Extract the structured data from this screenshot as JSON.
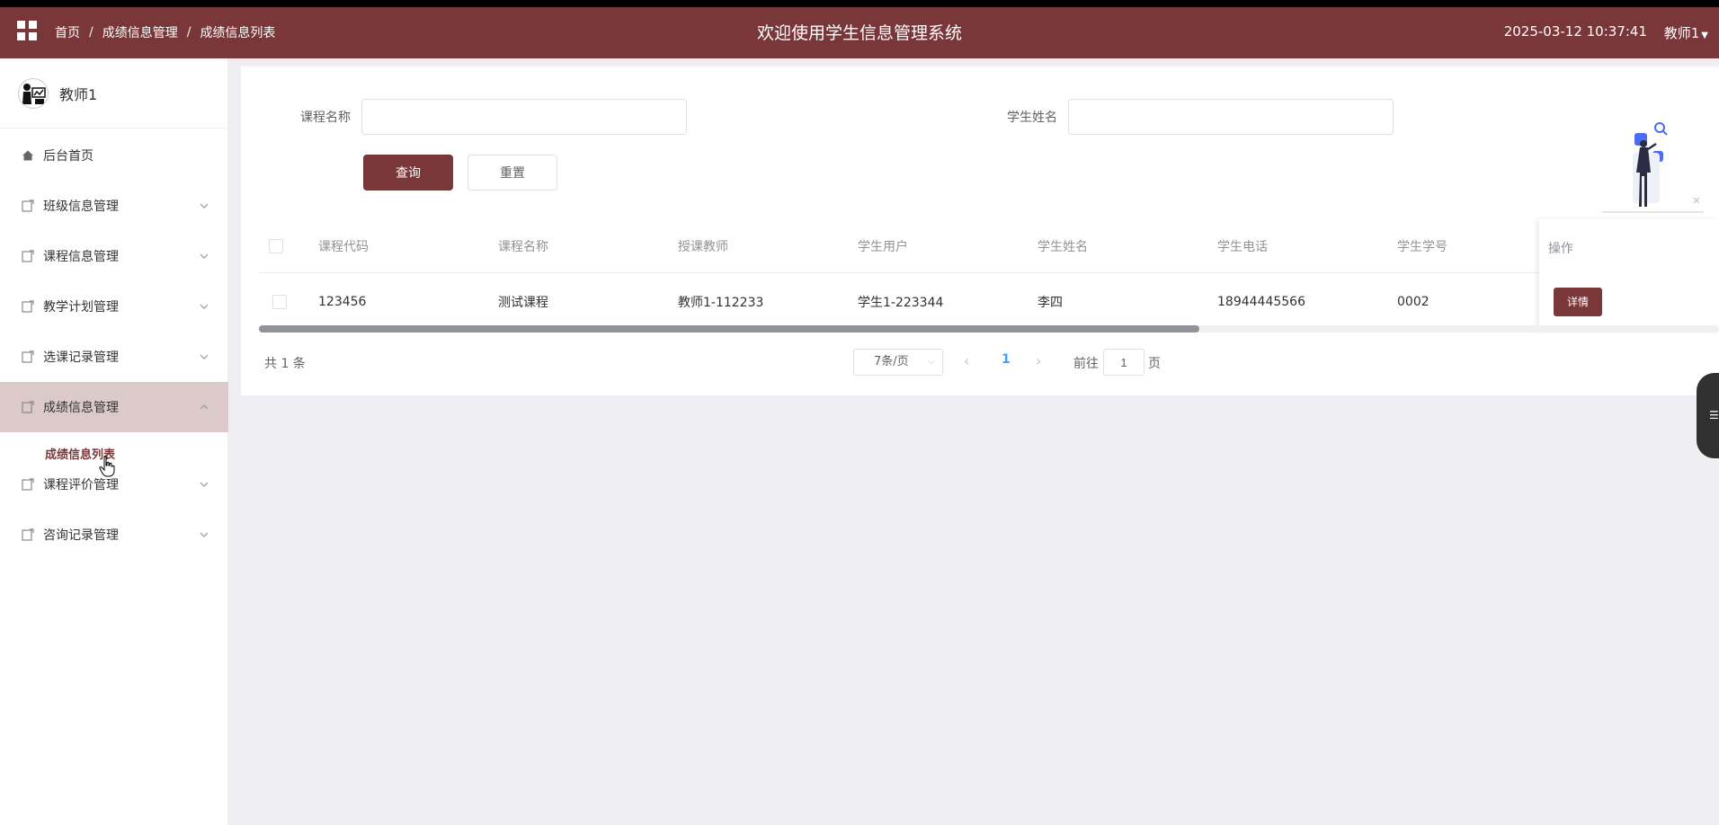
{
  "header": {
    "breadcrumb": [
      "首页",
      "成绩信息管理",
      "成绩信息列表"
    ],
    "title": "欢迎使用学生信息管理系统",
    "datetime": "2025-03-12 10:37:41",
    "user": "教师1"
  },
  "sidebar": {
    "profile_name": "教师1",
    "items": [
      {
        "label": "后台首页",
        "icon": "home-icon"
      },
      {
        "label": "班级信息管理",
        "icon": "doc-icon"
      },
      {
        "label": "课程信息管理",
        "icon": "doc-icon"
      },
      {
        "label": "教学计划管理",
        "icon": "doc-icon"
      },
      {
        "label": "选课记录管理",
        "icon": "doc-icon"
      },
      {
        "label": "成绩信息管理",
        "icon": "doc-icon"
      },
      {
        "label": "课程评价管理",
        "icon": "doc-icon"
      },
      {
        "label": "咨询记录管理",
        "icon": "doc-icon"
      }
    ],
    "subitem": "成绩信息列表"
  },
  "search": {
    "course_label": "课程名称",
    "student_label": "学生姓名",
    "course_value": "",
    "student_value": "",
    "query_label": "查询",
    "reset_label": "重置"
  },
  "table": {
    "columns": [
      "课程代码",
      "课程名称",
      "授课教师",
      "学生用户",
      "学生姓名",
      "学生电话",
      "学生学号"
    ],
    "ops_header": "操作",
    "rows": [
      [
        "123456",
        "测试课程",
        "教师1-112233",
        "学生1-223344",
        "李四",
        "18944445566",
        "0002"
      ]
    ],
    "detail_label": "详情"
  },
  "pager": {
    "total": "共 1 条",
    "size": "7条/页",
    "current": "1",
    "goto_prefix": "前往",
    "goto_value": "1",
    "goto_suffix": "页"
  },
  "colors": {
    "accent": "#7a373a",
    "active_menu_bg": "#dccaca",
    "page_bg": "#efeef3",
    "pager_active": "#409eff"
  }
}
